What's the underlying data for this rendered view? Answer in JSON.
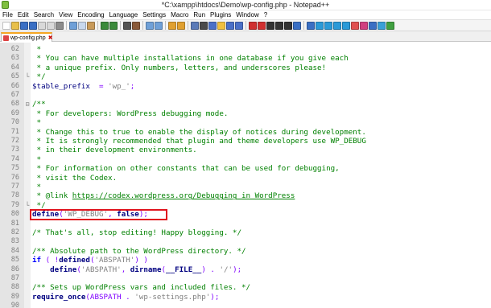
{
  "window": {
    "title": "*C:\\xampp\\htdocs\\Demo\\wp-config.php - Notepad++",
    "app_icon": "notepad-plus-plus-icon"
  },
  "menu": {
    "items": [
      "File",
      "Edit",
      "Search",
      "View",
      "Encoding",
      "Language",
      "Settings",
      "Macro",
      "Run",
      "Plugins",
      "Window",
      "?"
    ]
  },
  "toolbar": {
    "buttons": [
      {
        "name": "new-file-icon",
        "color": "#ffffff"
      },
      {
        "name": "open-file-icon",
        "color": "#e8c04a"
      },
      {
        "name": "save-icon",
        "color": "#3a6fc4"
      },
      {
        "name": "save-all-icon",
        "color": "#3a6fc4"
      },
      {
        "name": "close-icon",
        "color": "#d9d9d9"
      },
      {
        "name": "close-all-icon",
        "color": "#d9d9d9"
      },
      {
        "name": "print-icon",
        "color": "#8c8c8c"
      },
      {
        "sep": true
      },
      {
        "name": "cut-icon",
        "color": "#6fa0d8"
      },
      {
        "name": "copy-icon",
        "color": "#c8d8ee"
      },
      {
        "name": "paste-icon",
        "color": "#c89a5a"
      },
      {
        "sep": true
      },
      {
        "name": "undo-icon",
        "color": "#3b8a3b"
      },
      {
        "name": "redo-icon",
        "color": "#3b8a3b"
      },
      {
        "sep": true
      },
      {
        "name": "find-icon",
        "color": "#555555"
      },
      {
        "name": "replace-icon",
        "color": "#8a5a3a"
      },
      {
        "sep": true
      },
      {
        "name": "zoom-in-icon",
        "color": "#6fa0d8"
      },
      {
        "name": "zoom-out-icon",
        "color": "#6fa0d8"
      },
      {
        "sep": true
      },
      {
        "name": "sync-vertical-icon",
        "color": "#e0a030"
      },
      {
        "name": "sync-horizontal-icon",
        "color": "#e0a030"
      },
      {
        "sep": true
      },
      {
        "name": "word-wrap-icon",
        "color": "#5a7ab8"
      },
      {
        "name": "show-all-chars-icon",
        "color": "#4a4a4a"
      },
      {
        "name": "indent-guide-icon",
        "color": "#4a70c8"
      },
      {
        "name": "doc-map-icon",
        "color": "#f0c040"
      },
      {
        "name": "function-list-icon",
        "color": "#4a70c8"
      },
      {
        "name": "folder-workspace-icon",
        "color": "#4a70c8"
      },
      {
        "sep": true
      },
      {
        "name": "monitoring-icon",
        "color": "#d03030"
      },
      {
        "name": "record-macro-icon",
        "color": "#d03030"
      },
      {
        "name": "stop-macro-icon",
        "color": "#333333"
      },
      {
        "name": "play-macro-icon",
        "color": "#333333"
      },
      {
        "name": "run-macro-multiple-icon",
        "color": "#333333"
      },
      {
        "name": "save-macro-icon",
        "color": "#3a6fc4"
      },
      {
        "sep": true
      },
      {
        "name": "plugin-a-icon",
        "color": "#3a6fc4"
      },
      {
        "name": "plugin-b-icon",
        "color": "#2a9ad8"
      },
      {
        "name": "plugin-c-icon",
        "color": "#2a9ad8"
      },
      {
        "name": "plugin-d-icon",
        "color": "#2a9ad8"
      },
      {
        "name": "plugin-e-icon",
        "color": "#2a9ad8"
      },
      {
        "name": "plugin-f-icon",
        "color": "#e05050"
      },
      {
        "name": "plugin-g-icon",
        "color": "#d04080"
      },
      {
        "name": "plugin-h-icon",
        "color": "#3a6fc4"
      },
      {
        "name": "plugin-i-icon",
        "color": "#3aa0d8"
      },
      {
        "name": "plugin-j-icon",
        "color": "#40a040"
      }
    ]
  },
  "tab": {
    "label": "wp-config.php",
    "close_glyph": "✖",
    "accent": "#f5a623"
  },
  "editor": {
    "highlight_color": "#e0141e",
    "lines": [
      {
        "num": "62",
        "fold": "",
        "tokens": [
          {
            "t": " *",
            "c": "comment"
          }
        ]
      },
      {
        "num": "63",
        "fold": "",
        "tokens": [
          {
            "t": " * You can have multiple installations in one database if you give each",
            "c": "comment"
          }
        ]
      },
      {
        "num": "64",
        "fold": "",
        "tokens": [
          {
            "t": " * a unique prefix. Only numbers, letters, and underscores please!",
            "c": "comment"
          }
        ]
      },
      {
        "num": "65",
        "fold": "└",
        "tokens": [
          {
            "t": " */",
            "c": "comment"
          }
        ]
      },
      {
        "num": "66",
        "fold": "",
        "tokens": [
          {
            "t": "$table_prefix",
            "c": "var"
          },
          {
            "t": "  = ",
            "c": "op"
          },
          {
            "t": "'wp_'",
            "c": "str"
          },
          {
            "t": ";",
            "c": "op"
          }
        ]
      },
      {
        "num": "67",
        "fold": "",
        "tokens": []
      },
      {
        "num": "68",
        "fold": "⊟",
        "tokens": [
          {
            "t": "/**",
            "c": "comment"
          }
        ]
      },
      {
        "num": "69",
        "fold": "",
        "tokens": [
          {
            "t": " * For developers: WordPress debugging mode.",
            "c": "comment"
          }
        ]
      },
      {
        "num": "70",
        "fold": "",
        "tokens": [
          {
            "t": " *",
            "c": "comment"
          }
        ]
      },
      {
        "num": "71",
        "fold": "",
        "tokens": [
          {
            "t": " * Change this to true to enable the display of notices during development.",
            "c": "comment"
          }
        ]
      },
      {
        "num": "72",
        "fold": "",
        "tokens": [
          {
            "t": " * It is strongly recommended that plugin and theme developers use WP_DEBUG",
            "c": "comment"
          }
        ]
      },
      {
        "num": "73",
        "fold": "",
        "tokens": [
          {
            "t": " * in their development environments.",
            "c": "comment"
          }
        ]
      },
      {
        "num": "74",
        "fold": "",
        "tokens": [
          {
            "t": " *",
            "c": "comment"
          }
        ]
      },
      {
        "num": "75",
        "fold": "",
        "tokens": [
          {
            "t": " * For information on other constants that can be used for debugging,",
            "c": "comment"
          }
        ]
      },
      {
        "num": "76",
        "fold": "",
        "tokens": [
          {
            "t": " * visit the Codex.",
            "c": "comment"
          }
        ]
      },
      {
        "num": "77",
        "fold": "",
        "tokens": [
          {
            "t": " *",
            "c": "comment"
          }
        ]
      },
      {
        "num": "78",
        "fold": "",
        "tokens": [
          {
            "t": " * @link ",
            "c": "comment"
          },
          {
            "t": "https://codex.wordpress.org/Debugging_in_WordPress",
            "c": "link"
          }
        ]
      },
      {
        "num": "79",
        "fold": "└",
        "tokens": [
          {
            "t": " */",
            "c": "comment"
          }
        ]
      },
      {
        "num": "80",
        "fold": "",
        "tokens": [
          {
            "t": "define",
            "c": "func"
          },
          {
            "t": "(",
            "c": "op"
          },
          {
            "t": "'WP_DEBUG'",
            "c": "str"
          },
          {
            "t": ", ",
            "c": "op"
          },
          {
            "t": "false",
            "c": "func"
          },
          {
            "t": ");",
            "c": "op"
          }
        ],
        "boxed": true
      },
      {
        "num": "81",
        "fold": "",
        "tokens": []
      },
      {
        "num": "82",
        "fold": "",
        "tokens": [
          {
            "t": "/* That's all, stop editing! Happy blogging. */",
            "c": "comment"
          }
        ]
      },
      {
        "num": "83",
        "fold": "",
        "tokens": []
      },
      {
        "num": "84",
        "fold": "",
        "tokens": [
          {
            "t": "/** Absolute path to the WordPress directory. */",
            "c": "comment"
          }
        ]
      },
      {
        "num": "85",
        "fold": "",
        "tokens": [
          {
            "t": "if",
            "c": "keyword"
          },
          {
            "t": " ( ",
            "c": "op"
          },
          {
            "t": "!",
            "c": "op"
          },
          {
            "t": "defined",
            "c": "func"
          },
          {
            "t": "(",
            "c": "op"
          },
          {
            "t": "'ABSPATH'",
            "c": "str"
          },
          {
            "t": ") )",
            "c": "op"
          }
        ]
      },
      {
        "num": "86",
        "fold": "",
        "tokens": [
          {
            "t": "    ",
            "c": "plain"
          },
          {
            "t": "define",
            "c": "func"
          },
          {
            "t": "(",
            "c": "op"
          },
          {
            "t": "'ABSPATH'",
            "c": "str"
          },
          {
            "t": ", ",
            "c": "op"
          },
          {
            "t": "dirname",
            "c": "func"
          },
          {
            "t": "(",
            "c": "op"
          },
          {
            "t": "__FILE__",
            "c": "func"
          },
          {
            "t": ") . ",
            "c": "op"
          },
          {
            "t": "'/'",
            "c": "str"
          },
          {
            "t": ");",
            "c": "op"
          }
        ]
      },
      {
        "num": "87",
        "fold": "",
        "tokens": []
      },
      {
        "num": "88",
        "fold": "",
        "tokens": [
          {
            "t": "/** Sets up WordPress vars and included files. */",
            "c": "comment"
          }
        ]
      },
      {
        "num": "89",
        "fold": "",
        "tokens": [
          {
            "t": "require_once",
            "c": "func"
          },
          {
            "t": "(ABSPATH . ",
            "c": "op"
          },
          {
            "t": "'wp-settings.php'",
            "c": "str"
          },
          {
            "t": ");",
            "c": "op"
          }
        ]
      },
      {
        "num": "90",
        "fold": "",
        "tokens": []
      }
    ]
  }
}
